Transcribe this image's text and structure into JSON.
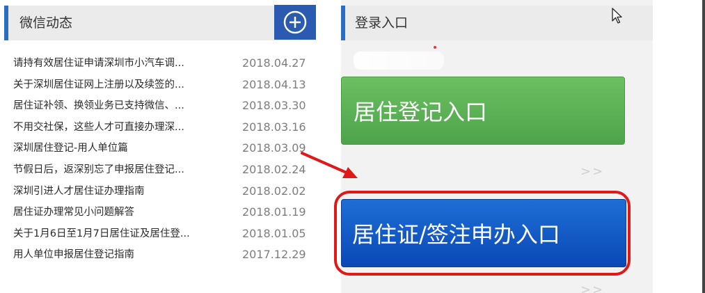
{
  "left": {
    "title": "微信动态",
    "add_icon": "plus-circle-icon",
    "news": [
      {
        "title": "请持有效居住证申请深圳市小汽车调...",
        "date": "2018.04.27"
      },
      {
        "title": "关于深圳居住证网上注册以及续签的...",
        "date": "2018.04.13"
      },
      {
        "title": "居住证补领、换领业务已支持微信、...",
        "date": "2018.03.30"
      },
      {
        "title": "不用交社保，这些人才可直接办理深...",
        "date": "2018.03.16"
      },
      {
        "title": "深圳居住登记-用人单位篇",
        "date": "2018.03.09"
      },
      {
        "title": "节假日后，返深别忘了申报居住登记...",
        "date": "2018.02.24"
      },
      {
        "title": "深圳引进人才居住证办理指南",
        "date": "2018.02.02"
      },
      {
        "title": "居住证办理常见小问题解答",
        "date": "2018.01.19"
      },
      {
        "title": "关于1月6日至1月7日居住证及居住登...",
        "date": "2018.01.05"
      },
      {
        "title": "用人单位申报居住登记指南",
        "date": "2017.12.29"
      }
    ]
  },
  "right": {
    "title": "登录入口",
    "residence_button": "居住登记入口",
    "permit_button": "居住证/签注申办入口",
    "more": ">>"
  },
  "colors": {
    "accent": "#2b6cc4",
    "green_button": "#5cb356",
    "blue_button": "#1059c4",
    "highlight": "#e01818"
  }
}
